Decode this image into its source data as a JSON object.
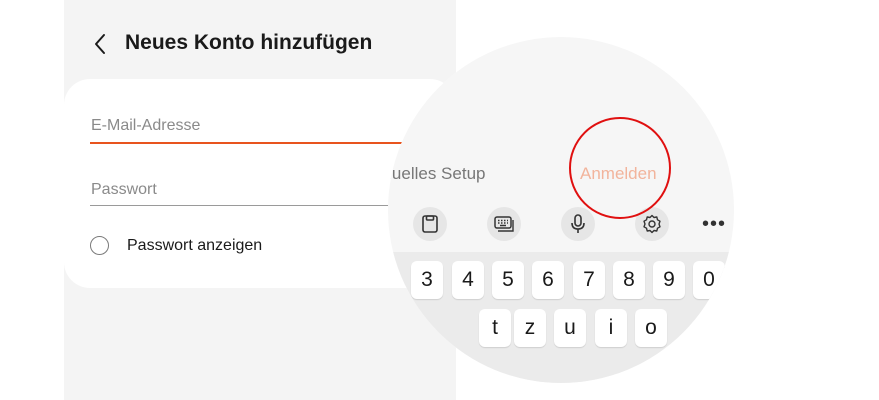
{
  "header": {
    "title": "Neues Konto hinzufügen",
    "back_icon": "chevron-left-icon"
  },
  "form": {
    "email_placeholder": "E-Mail-Adresse",
    "password_placeholder": "Passwort",
    "show_password_label": "Passwort anzeigen",
    "accent_color": "#e8541e"
  },
  "magnifier": {
    "manual_setup_label": "anuelles Setup",
    "sign_in_label": "Anmelden",
    "toolbar_icons": [
      "clipboard-icon",
      "keyboard-icon",
      "microphone-icon",
      "settings-icon",
      "more-icon"
    ],
    "more_label": "•••",
    "number_row": [
      "3",
      "4",
      "5",
      "6",
      "7",
      "8",
      "9",
      "0"
    ],
    "letter_row": [
      "t",
      "z",
      "u",
      "i",
      "o"
    ]
  },
  "highlight_color": "#e01010"
}
